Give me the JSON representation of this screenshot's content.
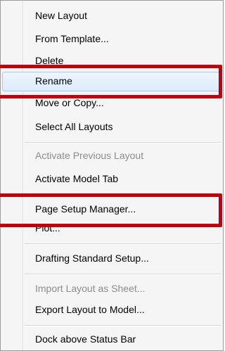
{
  "menu": {
    "items": [
      {
        "label": "New Layout",
        "enabled": true
      },
      {
        "label": "From Template...",
        "enabled": true
      },
      {
        "label": "Delete",
        "enabled": true
      },
      {
        "label": "Rename",
        "enabled": true,
        "state": "hover"
      },
      {
        "label": "Move or Copy...",
        "enabled": true
      },
      {
        "label": "Select All Layouts",
        "enabled": true
      },
      {
        "label": "Activate Previous Layout",
        "enabled": false
      },
      {
        "label": "Activate Model Tab",
        "enabled": true
      },
      {
        "label": "Page Setup Manager...",
        "enabled": true
      },
      {
        "label": "Plot...",
        "enabled": true
      },
      {
        "label": "Drafting Standard Setup...",
        "enabled": true
      },
      {
        "label": "Import Layout as Sheet...",
        "enabled": false
      },
      {
        "label": "Export Layout to Model...",
        "enabled": true
      },
      {
        "label": "Dock above Status Bar",
        "enabled": true
      }
    ]
  },
  "annotations": {
    "highlight_color": "#c0000f",
    "highlighted_items": [
      "Rename",
      "Page Setup Manager..."
    ]
  }
}
